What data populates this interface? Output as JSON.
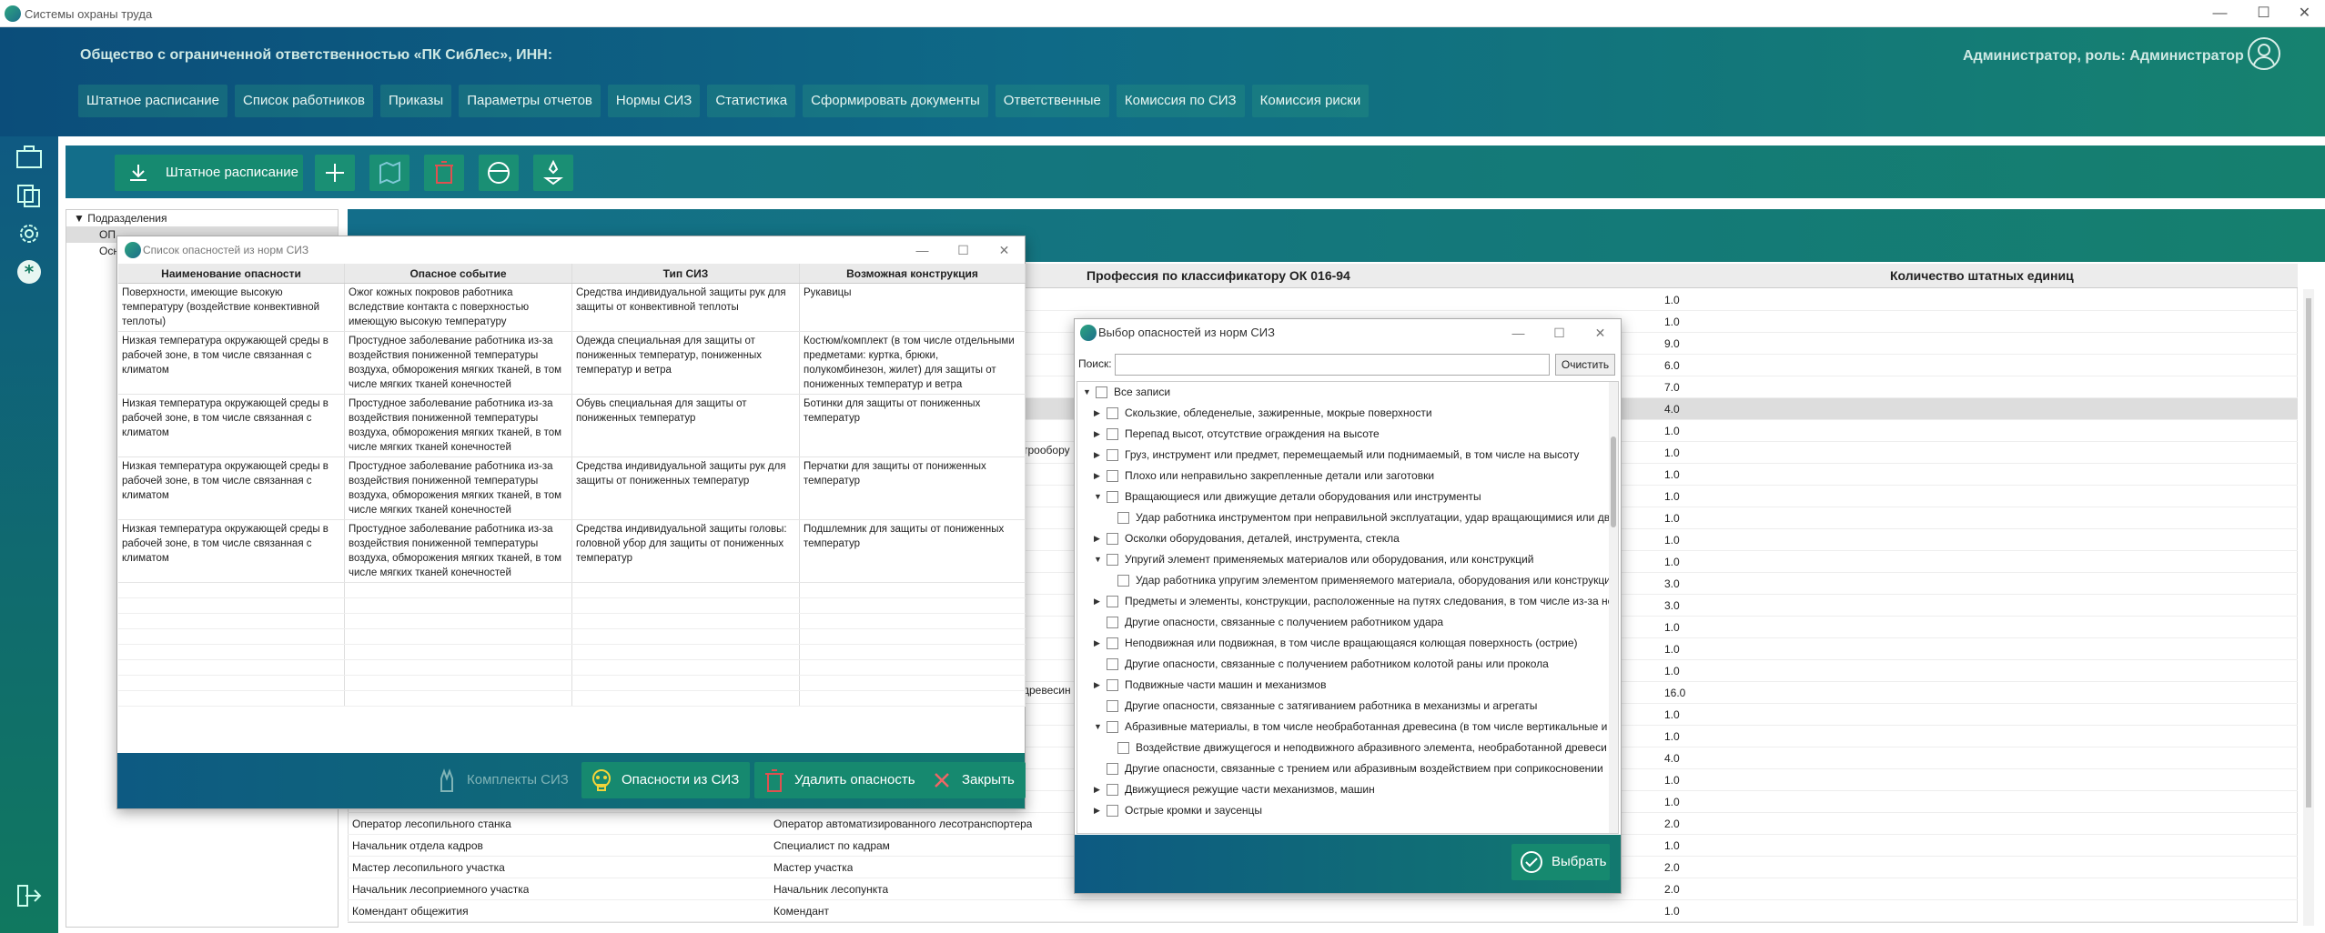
{
  "app": {
    "title": "Системы охраны труда"
  },
  "window_controls": {
    "minimize": "—",
    "maximize": "☐",
    "close": "✕"
  },
  "header": {
    "company": "Общество с ограниченной ответственностью «ПК СибЛес», ИНН:",
    "user": "Администратор, роль: Администратор"
  },
  "nav": [
    "Штатное расписание",
    "Список работников",
    "Приказы",
    "Параметры отчетов",
    "Нормы СИЗ",
    "Статистика",
    "Сформировать документы",
    "Ответственные",
    "Комиссия по СИЗ",
    "Комиссия риски"
  ],
  "toolbar": {
    "shtat_label": "Штатное расписание"
  },
  "tree": {
    "root": "Подразделения",
    "items": [
      "ОП",
      "Осн"
    ]
  },
  "bg_table": {
    "headers": [
      "Профессия по классификатору ОК 016-94",
      "Количество штатных единиц"
    ],
    "counts": [
      "1.0",
      "1.0",
      "9.0",
      "6.0",
      "7.0",
      "4.0",
      "1.0",
      "1.0",
      "1.0",
      "1.0",
      "1.0",
      "1.0",
      "1.0",
      "3.0",
      "3.0",
      "1.0",
      "1.0",
      "1.0",
      "16.0",
      "1.0",
      "1.0",
      "4.0",
      "1.0",
      "1.0",
      "2.0",
      "1.0",
      "2.0",
      "2.0",
      "1.0"
    ],
    "fragments": [
      "трообору",
      "древесин"
    ],
    "rows_visible": [
      {
        "name": "Оператор лесопильного станка",
        "prof": "Оператор автоматизированного лесотранспортера"
      },
      {
        "name": "Начальник отдела кадров",
        "prof": "Специалист по кадрам"
      },
      {
        "name": "Мастер лесопильного участка",
        "prof": "Мастер участка"
      },
      {
        "name": "Начальник лесоприемного участка",
        "prof": "Начальник лесопункта"
      },
      {
        "name": "Комендант общежития",
        "prof": "Комендант"
      }
    ]
  },
  "win1": {
    "title": "Список опасностей из норм СИЗ",
    "headers": [
      "Наименование опасности",
      "Опасное событие",
      "Тип СИЗ",
      "Возможная конструкция"
    ],
    "rows": [
      [
        "Поверхности, имеющие высокую температуру (воздействие конвективной теплоты)",
        "Ожог кожных покровов работника вследствие контакта с поверхностью имеющую высокую температуру",
        "Средства индивидуальной защиты рук для защиты от конвективной теплоты",
        "Рукавицы"
      ],
      [
        "Низкая температура окружающей среды в рабочей зоне, в том числе связанная с климатом",
        "Простудное заболевание работника из-за воздействия пониженной температуры воздуха, обморожения мягких тканей, в том числе мягких тканей конечностей",
        "Одежда специальная для защиты от пониженных температур, пониженных температур и ветра",
        "Костюм/комплект (в том числе отдельными предметами: куртка, брюки, полукомбинезон, жилет) для защиты от пониженных температур и ветра"
      ],
      [
        "Низкая температура окружающей среды в рабочей зоне, в том числе связанная с климатом",
        "Простудное заболевание работника из-за воздействия пониженной температуры воздуха, обморожения мягких тканей, в том числе мягких тканей конечностей",
        "Обувь специальная для защиты от пониженных температур",
        "Ботинки для защиты от пониженных температур"
      ],
      [
        "Низкая температура окружающей среды в рабочей зоне, в том числе связанная с климатом",
        "Простудное заболевание работника из-за воздействия пониженной температуры воздуха, обморожения мягких тканей, в том числе мягких тканей конечностей",
        "Средства индивидуальной защиты рук для защиты от пониженных температур",
        "Перчатки для защиты от пониженных температур"
      ],
      [
        "Низкая температура окружающей среды в рабочей зоне, в том числе связанная с климатом",
        "Простудное заболевание работника из-за воздействия пониженной температуры воздуха, обморожения мягких тканей, в том числе мягких тканей конечностей",
        "Средства индивидуальной защиты головы: головной убор для защиты от пониженных температур",
        "Подшлемник для защиты от пониженных температур"
      ]
    ],
    "buttons": {
      "kits": "Комплекты СИЗ",
      "hazards": "Опасности из СИЗ",
      "delete": "Удалить опасность",
      "close": "Закрыть"
    }
  },
  "win2": {
    "title": "Выбор опасностей из норм СИЗ",
    "search_label": "Поиск:",
    "search_value": "",
    "clear": "Очистить",
    "root": "Все записи",
    "nodes": [
      {
        "label": "Скользкие, обледенелые, зажиренные, мокрые поверхности",
        "level": 1,
        "arrow": "▶"
      },
      {
        "label": "Перепад высот, отсутствие ограждения на высоте",
        "level": 1,
        "arrow": "▶"
      },
      {
        "label": "Груз, инструмент или предмет, перемещаемый или поднимаемый, в том числе на высоту",
        "level": 1,
        "arrow": "▶"
      },
      {
        "label": "Плохо или неправильно закрепленные детали или заготовки",
        "level": 1,
        "arrow": "▶"
      },
      {
        "label": "Вращающиеся или движущие детали оборудования или инструменты",
        "level": 1,
        "arrow": "▼"
      },
      {
        "label": "Удар работника инструментом при неправильной эксплуатации, удар вращающимися или дв",
        "level": 2,
        "arrow": ""
      },
      {
        "label": "Осколки оборудования, деталей, инструмента, стекла",
        "level": 1,
        "arrow": "▶"
      },
      {
        "label": "Упругий элемент применяемых материалов или оборудования, или конструкций",
        "level": 1,
        "arrow": "▼"
      },
      {
        "label": "Удар работника упругим элементом применяемого материала, оборудования или конструкци",
        "level": 2,
        "arrow": ""
      },
      {
        "label": "Предметы и элементы, конструкции, расположенные на путях следования, в том числе из-за не",
        "level": 1,
        "arrow": "▶"
      },
      {
        "label": "Другие опасности, связанные с получением работником удара",
        "level": 1,
        "arrow": ""
      },
      {
        "label": "Неподвижная или подвижная, в том числе вращающаяся колющая поверхность (острие)",
        "level": 1,
        "arrow": "▶"
      },
      {
        "label": "Другие опасности, связанные с получением работником колотой раны или прокола",
        "level": 1,
        "arrow": ""
      },
      {
        "label": "Подвижные части машин и механизмов",
        "level": 1,
        "arrow": "▶"
      },
      {
        "label": "Другие опасности, связанные с затягиванием работника в механизмы и агрегаты",
        "level": 1,
        "arrow": ""
      },
      {
        "label": "Абразивные материалы, в том числе необработанная древесина (в том числе вертикальные и г",
        "level": 1,
        "arrow": "▼"
      },
      {
        "label": "Воздействие движущегося и неподвижного абразивного элемента, необработанной древеси",
        "level": 2,
        "arrow": ""
      },
      {
        "label": "Другие опасности, связанные с трением или абразивным воздействием при соприкосновении",
        "level": 1,
        "arrow": ""
      },
      {
        "label": "Движущиеся режущие части механизмов, машин",
        "level": 1,
        "arrow": "▶"
      },
      {
        "label": "Острые кромки и заусенцы",
        "level": 1,
        "arrow": "▶"
      }
    ],
    "select": "Выбрать"
  },
  "colors": {
    "accent": "#16896f",
    "header_blue": "#0b4d7a"
  }
}
